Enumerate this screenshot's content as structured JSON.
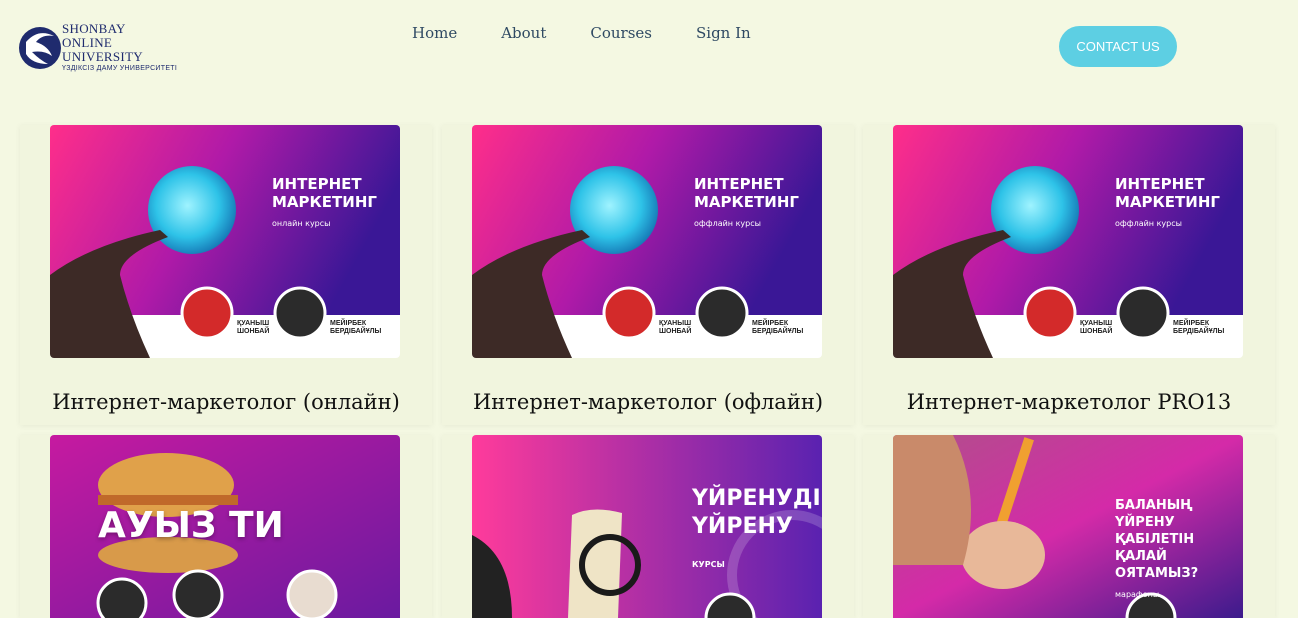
{
  "header": {
    "logo_lines": [
      "SHONBAY",
      "ONLINE",
      "UNIVERSITY"
    ],
    "logo_sub": "ҮЗДІКСІЗ ДАМУ УНИВЕРСИТЕТІ",
    "nav": [
      "Home",
      "About",
      "Courses",
      "Sign In"
    ],
    "contact_label": "CONTACT US"
  },
  "cards": [
    {
      "title": "Интернет-маркетолог (онлайн)",
      "img_title1": "ИНТЕРНЕТ",
      "img_title2": "МАРКЕТИНГ",
      "img_sub": "онлайн курсы",
      "p1": "ҚУАНЫШ\nШОНБАЙ",
      "p2": "МЕЙІРБЕК\nБЕРДІБАЙҰЛЫ"
    },
    {
      "title": "Интернет-маркетолог (офлайн)",
      "img_title1": "ИНТЕРНЕТ",
      "img_title2": "МАРКЕТИНГ",
      "img_sub": "оффлайн курсы",
      "p1": "ҚУАНЫШ\nШОНБАЙ",
      "p2": "МЕЙІРБЕК\nБЕРДІБАЙҰЛЫ"
    },
    {
      "title": "Интернет-маркетолог PRO13",
      "img_title1": "ИНТЕРНЕТ",
      "img_title2": "МАРКЕТИНГ",
      "img_sub": "оффлайн курсы",
      "p1": "ҚУАНЫШ\nШОНБАЙ",
      "p2": "МЕЙІРБЕК\nБЕРДІБАЙҰЛЫ"
    },
    {
      "img_title1": "АУЫЗ ТИ"
    },
    {
      "img_title1": "ҮЙРЕНУДІ",
      "img_title2": "ҮЙРЕНУ",
      "img_sub": "КУРСЫ"
    },
    {
      "img_title1": "БАЛАНЫҢ ҮЙРЕНУ",
      "img_title2": "ҚАБІЛЕТІН ҚАЛАЙ",
      "img_title3": "ОЯТАМЫЗ?",
      "img_sub": "марафоны"
    }
  ],
  "colors": {
    "background": "#f4f8e2",
    "contact_button": "#5dcfe3",
    "nav_text": "#2f4a63",
    "logo": "#1f2b6e"
  }
}
